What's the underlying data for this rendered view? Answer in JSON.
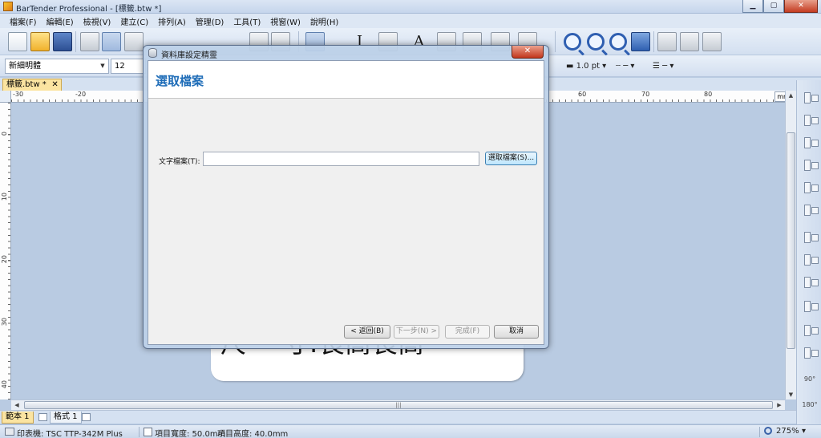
{
  "app": {
    "title": "BarTender Professional - [標籤.btw *]"
  },
  "window_buttons": {
    "minimize": "▁",
    "maximize": "▢",
    "close": "✕"
  },
  "menu": [
    "檔案(F)",
    "編輯(E)",
    "檢視(V)",
    "建立(C)",
    "排列(A)",
    "管理(D)",
    "工具(T)",
    "視窗(W)",
    "說明(H)"
  ],
  "toolbar2": {
    "font_name": "新細明體",
    "font_size": "12",
    "line_width": "1.0 pt"
  },
  "document_tab": {
    "label": "標籤.btw *",
    "close": "✕"
  },
  "ruler": {
    "unit": "mm",
    "h_ticks": [
      "-30",
      "-20",
      "60",
      "70",
      "80"
    ],
    "v_ticks": [
      "0",
      "10",
      "20",
      "30",
      "40"
    ]
  },
  "label_preview": {
    "text": "尺    寸:長高長高"
  },
  "right_panel": {
    "rotate_90": "90°",
    "rotate_180": "180°"
  },
  "page_tabs": {
    "template": "範本 1",
    "form": "格式 1"
  },
  "status": {
    "printer": "印表機: TSC TTP-342M Plus",
    "item_width": "項目寬度: 50.0mm",
    "item_height": "項目高度: 40.0mm",
    "zoom": "275%"
  },
  "dialog": {
    "title": "資料庫設定精靈",
    "close": "✕",
    "heading": "選取檔案",
    "field_label": "文字檔案(T):",
    "field_value": "",
    "browse_button": "選取檔案(S)...",
    "back_button": "< 返回(B)",
    "next_button": "下一步(N) >",
    "finish_button": "完成(F)",
    "cancel_button": "取消"
  }
}
